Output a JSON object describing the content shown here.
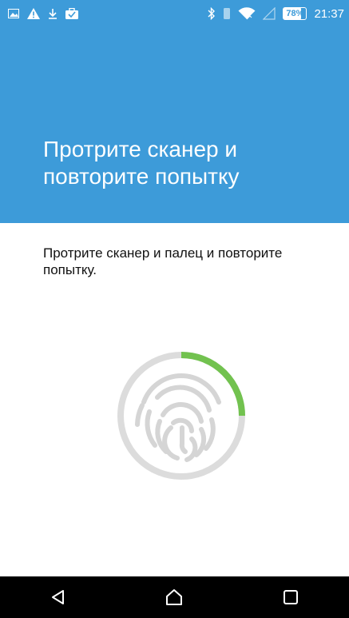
{
  "status_bar": {
    "time": "21:37",
    "battery_text": "78%",
    "battery_level": 0.78,
    "left_icons": [
      "image-icon",
      "warning-icon",
      "download-icon",
      "briefcase-icon"
    ],
    "right_icons": [
      "bluetooth-icon",
      "vibrate-icon",
      "wifi-icon",
      "signal-icon",
      "battery-icon"
    ]
  },
  "header": {
    "title": "Протрите сканер и повторите попытку",
    "background_color": "#3d9bd9"
  },
  "main": {
    "message": "Протрите сканер и палец и повторите попытку."
  },
  "fingerprint": {
    "progress": 0.25,
    "progress_color": "#72c24f",
    "ring_color": "#dcdcdc",
    "icon": "fingerprint-icon"
  },
  "nav_bar": {
    "buttons": [
      "back-icon",
      "home-icon",
      "recents-icon"
    ]
  }
}
